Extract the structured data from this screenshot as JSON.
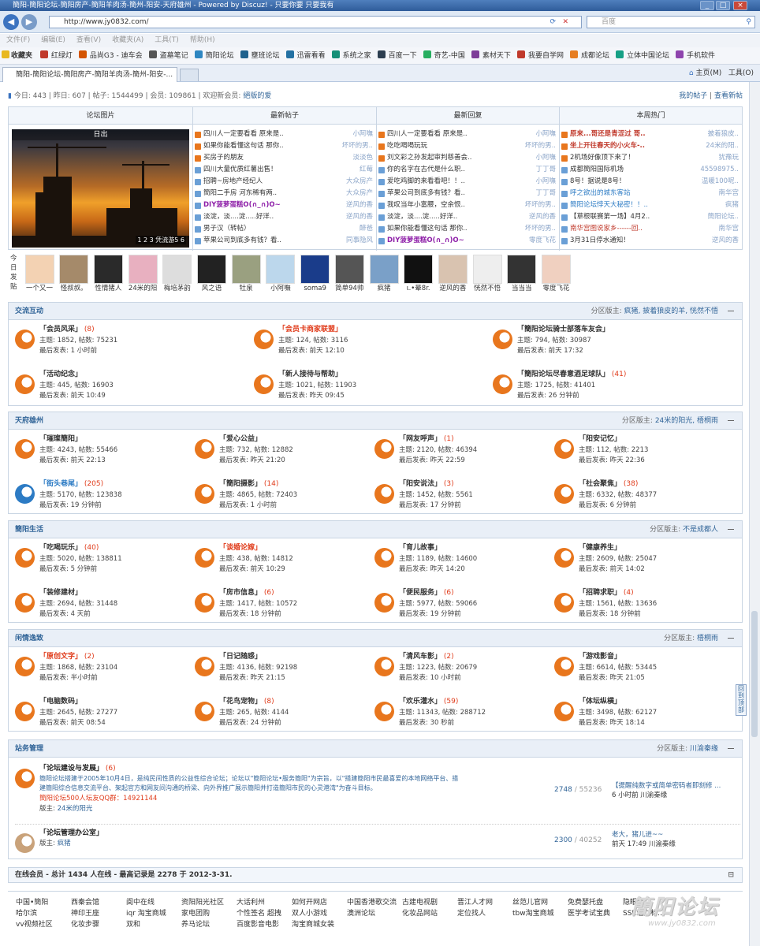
{
  "browser": {
    "title": "簡阳-簡阳论坛-簡阳房产-簡阳羊肉汤-簡州-阳安-天府雄州 - Powered by Discuz! - 只要你要  只要我有",
    "address": "http://www.jy0832.com/",
    "search_placeholder": "百度",
    "menu": [
      "文件(F)",
      "编辑(E)",
      "查看(V)",
      "收藏夹(A)",
      "工具(T)",
      "帮助(H)"
    ],
    "fav_label": "收藏夹",
    "favorites": [
      "红绿灯",
      "品尚G3 - 迪车会",
      "盗墓笔记",
      "簡阳论坛",
      "壅班论坛",
      "迅雷看看",
      "系统之家",
      "百度一下",
      "奇艺-中国",
      "素材天下",
      "我要自学网",
      "成都论坛",
      "立体中国论坛",
      "手机软件"
    ],
    "tab": "簡阳-簡阳论坛-簡阳房产-簡阳羊肉汤-簡州-阳安-...",
    "home": "主页(M)",
    "tools": "工具(O)"
  },
  "stats": {
    "today_label": "今日:",
    "today": "443",
    "yest_label": "昨日:",
    "yesterday": "607",
    "posts_label": "帖子:",
    "posts": "1544499",
    "members_label": "会员:",
    "members": "109861",
    "welcome": "欢迎新会员:",
    "newmember": "絕版的爱",
    "my": "我的帖子",
    "new": "查看新帖"
  },
  "panel": {
    "h1": "论坛图片",
    "h2": "最新帖子",
    "h3": "最新回复",
    "h4": "本周热门",
    "photo_caption": "日出",
    "photo_nums": "1  2  3  凭流游5 6",
    "latest": [
      [
        "四川人一定要看看 原来是..",
        "小阿嘸"
      ],
      [
        "如果你能看懂这句话 那你..",
        "坏坏的男.."
      ],
      [
        "买房子的朋友",
        "淡淡色"
      ],
      [
        "四川大量优质红薯出售！",
        "红莓"
      ],
      [
        "招聘~房地产经纪人",
        "大众房产"
      ],
      [
        "簡阳二手房 河东稀有两..",
        "大众房产"
      ],
      [
        "DIY菠萝蛋糕O(∩_∩)O~",
        "逆风的香"
      ],
      [
        "淡淀，淡....淀.....好洋..",
        "逆风的香"
      ],
      [
        "男子汉（转帖）",
        "醉爸"
      ],
      [
        "苹果公司到底多有钱？看..",
        "同事隐风"
      ]
    ],
    "replies": [
      [
        "四川人一定要看看 原来是..",
        "小阿嘸"
      ],
      [
        "吃吃喝喝玩玩",
        "坏坏的男.."
      ],
      [
        "刘文彩之孙发起审判慈善会..",
        "小阿嘸"
      ],
      [
        "你的名字在古代是什么职..",
        "丁丁哥"
      ],
      [
        "爱吃鸡脚的来看看吧！！..",
        "小阿嘸"
      ],
      [
        "苹果公司到底多有钱？看..",
        "丁丁哥"
      ],
      [
        "我叹当年小富腰，空余恨..",
        "坏坏的男.."
      ],
      [
        "淡淀，淡....淀.....好洋..",
        "逆风的香"
      ],
      [
        "如果你能看懂这句话 那你..",
        "坏坏的男.."
      ],
      [
        "DIY菠萝蛋糕O(∩_∩)O~",
        "零度飞花"
      ]
    ],
    "hot": [
      [
        "原来...哥还是青涩过 哥..",
        "披着狼皮.."
      ],
      [
        "坐上开往春天的小火车-..",
        "24米的阳.."
      ],
      [
        "2机场好像顶下来了！",
        "犹豫玩"
      ],
      [
        "成都簡阳国际机场",
        "45598975.."
      ],
      [
        "8号！据说是8号！",
        "温暖100呢.."
      ],
      [
        "呼之欲出的城东客站",
        "南华宫"
      ],
      [
        "簡阳论坛悖天大秘密！！..",
        "疯猪"
      ],
      [
        "【草根联赛第一场】4月2..",
        "簡阳论坛.."
      ],
      [
        "南华宫图说家乡------回..",
        "南华宫"
      ],
      [
        "3月31日停水通知！",
        "逆风的香"
      ]
    ]
  },
  "today_label": "今日发贴",
  "avatars": [
    "一个又一",
    "怪叔叔。",
    "性情猪人",
    "24米的阳",
    "梅培茅韵",
    "风之语",
    "牡泉",
    "小阿嘸",
    "soma9",
    "简单94帅",
    "疯猪",
    "ι.•晕8r.",
    "逆风的香",
    "恍然不悟",
    "当当当",
    "零度飞花"
  ],
  "sections": [
    {
      "name": "交流互动",
      "mod_label": "分区版主:",
      "mods": "疯猪, 披着狼皮的羊, 恍然不悟",
      "forums": [
        {
          "name": "「会员风采」",
          "extra": "(8)",
          "style": "b",
          "topics": "主题: 1852, 帖数: 75231",
          "last": "最后发表: 1 小时前"
        },
        {
          "name": "「会员卡商家联盟」",
          "extra": "",
          "style": "hot",
          "topics": "主题: 124, 帖数: 3116",
          "last": "最后发表: 前天 12:10"
        },
        {
          "name": "「簡阳论坛骑士部落车友会」",
          "extra": "",
          "style": "b",
          "topics": "主题: 794, 帖数: 30987",
          "last": "最后发表: 前天 17:32"
        },
        {
          "name": "「活动纪念」",
          "extra": "",
          "style": "b",
          "topics": "主题: 445, 帖数: 16903",
          "last": "最后发表: 前天 10:49"
        },
        {
          "name": "「新人接待与帮助」",
          "extra": "",
          "style": "b",
          "topics": "主题: 1021, 帖数: 11903",
          "last": "最后发表: 昨天 09:45"
        },
        {
          "name": "「簡阳论坛尽春意酒足球队」",
          "extra": "(41)",
          "style": "b",
          "topics": "主题: 1725, 帖数: 41401",
          "last": "最后发表: 26 分钟前"
        }
      ]
    },
    {
      "name": "天府雄州",
      "mod_label": "分区版主:",
      "mods": "24米的阳光, 梧桐雨",
      "forums": [
        {
          "name": "「璀璨簡阳」",
          "extra": "",
          "style": "b",
          "topics": "主题: 4243, 帖数: 55466",
          "last": "最后发表: 前天 22:13"
        },
        {
          "name": "「爱心公益」",
          "extra": "",
          "style": "b",
          "topics": "主题: 732, 帖数: 12882",
          "last": "最后发表: 昨天 21:20"
        },
        {
          "name": "「网友呼声」",
          "extra": "(1)",
          "style": "b",
          "topics": "主题: 2120, 帖数: 46394",
          "last": "最后发表: 昨天 22:59"
        },
        {
          "name": "「阳安记忆」",
          "extra": "",
          "style": "b",
          "topics": "主题: 112, 帖数: 2213",
          "last": "最后发表: 昨天 22:36"
        },
        {
          "name": "「街头巷尾」",
          "extra": "(205)",
          "style": "blu",
          "topics": "主题: 5170, 帖数: 123838",
          "last": "最后发表: 19 分钟前"
        },
        {
          "name": "「簡阳摄影」",
          "extra": "(14)",
          "style": "b",
          "topics": "主题: 4865, 帖数: 72403",
          "last": "最后发表: 1 小时前"
        },
        {
          "name": "「阳安说法」",
          "extra": "(3)",
          "style": "b",
          "topics": "主题: 1452, 帖数: 5561",
          "last": "最后发表: 17 分钟前"
        },
        {
          "name": "「社会聚焦」",
          "extra": "(38)",
          "style": "b",
          "topics": "主题: 6332, 帖数: 48377",
          "last": "最后发表: 6 分钟前"
        }
      ]
    },
    {
      "name": "簡阳生活",
      "mod_label": "分区版主:",
      "mods": "不是成都人",
      "forums": [
        {
          "name": "「吃喝玩乐」",
          "extra": "(40)",
          "style": "b",
          "topics": "主题: 5020, 帖数: 138811",
          "last": "最后发表: 5 分钟前"
        },
        {
          "name": "「谈婚论嫁」",
          "extra": "",
          "style": "hot",
          "topics": "主题: 438, 帖数: 14812",
          "last": "最后发表: 前天 10:29"
        },
        {
          "name": "「育儿故事」",
          "extra": "",
          "style": "b",
          "topics": "主题: 1189, 帖数: 14600",
          "last": "最后发表: 昨天 14:20"
        },
        {
          "name": "「健康养生」",
          "extra": "",
          "style": "b",
          "topics": "主题: 2609, 帖数: 25047",
          "last": "最后发表: 前天 14:02"
        },
        {
          "name": "「装修建材」",
          "extra": "",
          "style": "b",
          "topics": "主题: 2694, 帖数: 31448",
          "last": "最后发表: 4 天前"
        },
        {
          "name": "「房市信息」",
          "extra": "(6)",
          "style": "b",
          "topics": "主题: 1417, 帖数: 10572",
          "last": "最后发表: 18 分钟前"
        },
        {
          "name": "「便民服务」",
          "extra": "(6)",
          "style": "b",
          "topics": "主题: 5977, 帖数: 59066",
          "last": "最后发表: 19 分钟前"
        },
        {
          "name": "「招聘求职」",
          "extra": "(4)",
          "style": "b",
          "topics": "主题: 1561, 帖数: 13636",
          "last": "最后发表: 18 分钟前"
        }
      ]
    },
    {
      "name": "闲情逸致",
      "mod_label": "分区版主:",
      "mods": "梧桐雨",
      "forums": [
        {
          "name": "「原创文字」",
          "extra": "(2)",
          "style": "hot",
          "topics": "主题: 1868, 帖数: 23104",
          "last": "最后发表: 半小时前"
        },
        {
          "name": "「日记随感」",
          "extra": "",
          "style": "b",
          "topics": "主题: 4136, 帖数: 92198",
          "last": "最后发表: 昨天 21:15"
        },
        {
          "name": "「清风车影」",
          "extra": "(2)",
          "style": "b",
          "topics": "主题: 1223, 帖数: 20679",
          "last": "最后发表: 10 小时前"
        },
        {
          "name": "「游戏影音」",
          "extra": "",
          "style": "b",
          "topics": "主题: 6614, 帖数: 53445",
          "last": "最后发表: 昨天 21:05"
        },
        {
          "name": "「电脑数码」",
          "extra": "",
          "style": "b",
          "topics": "主题: 2645, 帖数: 27277",
          "last": "最后发表: 前天 08:54"
        },
        {
          "name": "「花鸟宠物」",
          "extra": "(8)",
          "style": "b",
          "topics": "主题: 265, 帖数: 4144",
          "last": "最后发表: 24 分钟前"
        },
        {
          "name": "「欢乐灌水」",
          "extra": "(59)",
          "style": "b",
          "topics": "主题: 11343, 帖数: 288712",
          "last": "最后发表: 30 秒前"
        },
        {
          "name": "「体坛纵横」",
          "extra": "",
          "style": "b",
          "topics": "主题: 3498, 帖数: 62127",
          "last": "最后发表: 昨天 18:14"
        }
      ]
    }
  ],
  "admin": {
    "name": "站务管理",
    "mod_label": "分区版主:",
    "mods": "川渝秦缘",
    "f1": {
      "name": "「论坛建设与发展」",
      "extra": "(6)",
      "desc1": "簡阳论坛搭建于2005年10月4日，是纯民间性质的公益性综合论坛；论坛以\"簡阳论坛•服务簡阳\"为宗旨，以\"搭建簡阳市民最喜爱的本地网络平台、搭",
      "desc2": "建簡阳综合信息交流平台、架起官方和网友间沟通的桥梁、向外界推广展示簡阳并打造簡阳市民的心灵港湾\"为奋斗目标。",
      "qq": "簡阳论坛500人坛友QQ群：14921144",
      "mod": "版主:",
      "modname": "24米的阳光",
      "count": "2748",
      "total": "/ 55236",
      "last": "【提醒纯数字或简单密码者即刻修 ...",
      "lasttime": "6 小时前 川渝秦缘"
    },
    "f2": {
      "name": "「论坛管理办公室」",
      "mod": "版主:",
      "modname": "疯猪",
      "count": "2300",
      "total": "/ 40252",
      "last": "老大，猪儿进~~",
      "lasttime": "前天 17:49 川渝秦缘"
    }
  },
  "online": "在线会员 - 总计 1434 人在线 - 最高记录是 2278 于 2012-3-31.",
  "links": [
    [
      "中国•簡阳",
      "西秦会馆",
      "阆中在线",
      "资阳阳光社区",
      "大话利州",
      "如何开网店",
      "中国香港歌交流",
      "古建电视剧",
      "晋江人才网",
      "丝范儿官网",
      "免费瑟托盘",
      "隐眼票"
    ],
    [
      "哈尔滨",
      "神印王座",
      "iqr 淘宝商城",
      "家电团购",
      "个性签名 超拽",
      "双人小游戏",
      "澳洲论坛",
      "化妆品网站",
      "定位找人",
      "tbw淘宝商城",
      "医学考试宝典",
      "SSE站立标..."
    ],
    [
      "vv视频社区",
      "化妆步骤",
      "双和",
      "养马论坛",
      "百度影音电影",
      "淘宝商城女装"
    ]
  ],
  "watermark": "簡阳论坛",
  "watermark_url": "www.jy0832.com",
  "sidebtn": "回到顶部"
}
